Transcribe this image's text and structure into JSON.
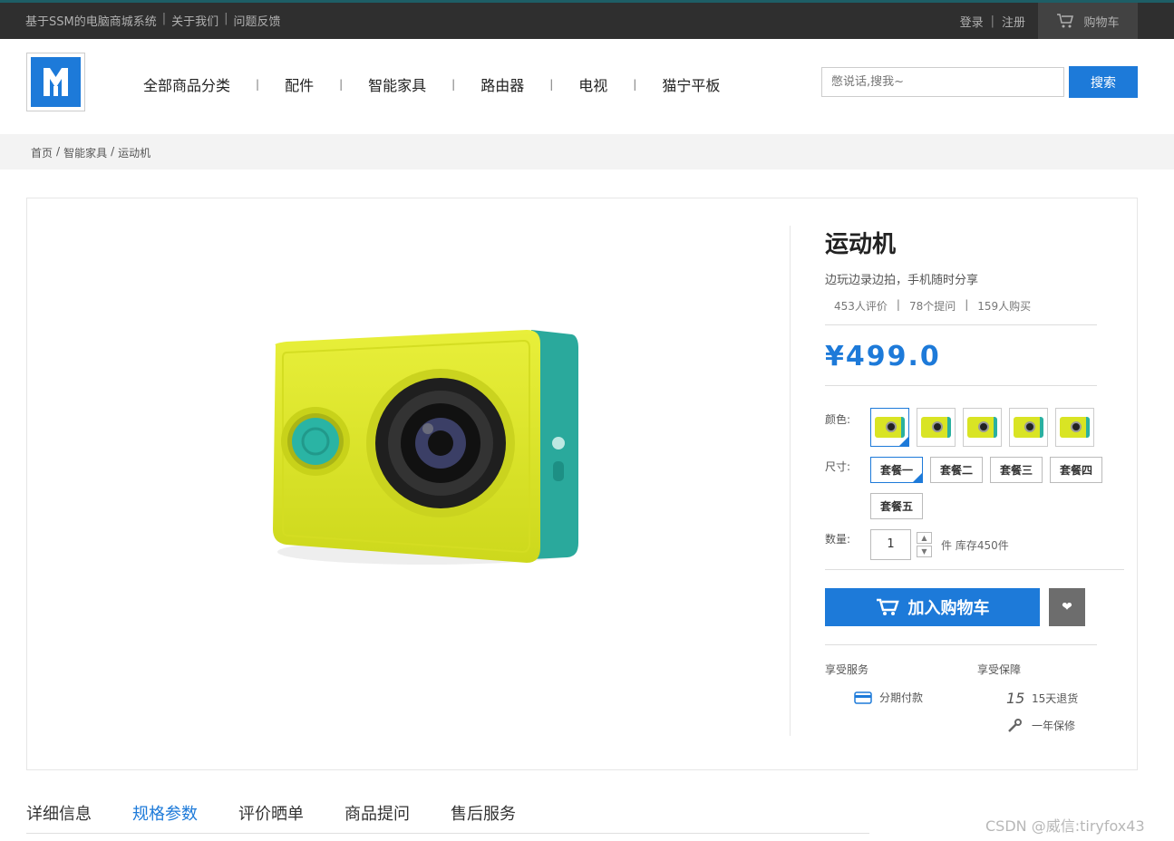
{
  "topbar": {
    "site_name": "基于SSM的电脑商城系统",
    "about": "关于我们",
    "feedback": "问题反馈",
    "login": "登录",
    "register": "注册",
    "cart": "购物车"
  },
  "header": {
    "nav": [
      "全部商品分类",
      "配件",
      "智能家具",
      "路由器",
      "电视",
      "猫宁平板"
    ],
    "search_placeholder": "憋说话,搜我~",
    "search_button": "搜索"
  },
  "breadcrumb": [
    "首页",
    "智能家具",
    "运动机"
  ],
  "product": {
    "title": "运动机",
    "subtitle": "边玩边录边拍，手机随时分享",
    "reviews": "453人评价",
    "questions": "78个提问",
    "buyers": "159人购买",
    "price": "¥499.0",
    "color_label": "颜色:",
    "size_label": "尺寸:",
    "qty_label": "数量:",
    "sizes": [
      "套餐一",
      "套餐二",
      "套餐三",
      "套餐四",
      "套餐五"
    ],
    "quantity": "1",
    "stock": "件 库存450件",
    "add_to_cart": "加入购物车",
    "services_title": "享受服务",
    "guarantee_title": "享受保障",
    "service_installment": "分期付款",
    "guarantee_return": "15天退货",
    "guarantee_return_icon_text": "15",
    "guarantee_warranty": "一年保修",
    "accent": "#1d7ad9"
  },
  "tabs": [
    "详细信息",
    "规格参数",
    "评价晒单",
    "商品提问",
    "售后服务"
  ],
  "active_tab": "规格参数",
  "watermark": "CSDN @威信:tiryfox43"
}
